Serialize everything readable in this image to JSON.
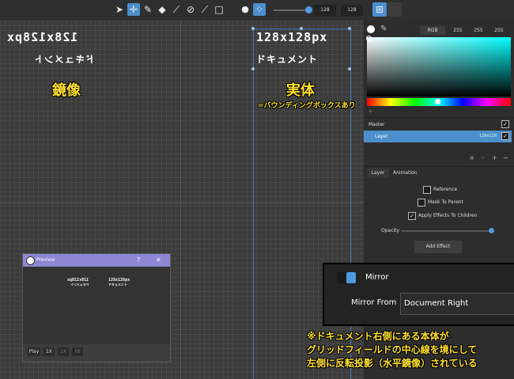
{
  "toolbar": {
    "tools": [
      "select-tool",
      "move-tool",
      "pen-tool",
      "eraser-tool",
      "line-tool",
      "fill-tool",
      "brush-tool",
      "rectangle-tool"
    ],
    "brush_size_a": "128",
    "brush_size_b": "128"
  },
  "canvas": {
    "mirror_line1": "128x128px",
    "mirror_line2": "ドキュメント",
    "mirror_label": "鏡像",
    "real_line1": "128x128px",
    "real_line2": "ドキュメント",
    "real_label": "実体",
    "real_sublabel": "=バウンディングボックスあり"
  },
  "color": {
    "mode": "RGB",
    "r": "255",
    "g": "255",
    "b": "255"
  },
  "layers": {
    "master": "Master",
    "layer": "Layer",
    "layer_info": "128x128"
  },
  "tabs": [
    "Layer",
    "Animation"
  ],
  "layer_props": {
    "reference": "Reference",
    "mask": "Mask To Parent",
    "apply_effects": "Apply Effects To Children",
    "opacity": "Opacity",
    "opacity_value": 1.0,
    "add_effect": "Add Effect"
  },
  "preview": {
    "title": "Preview",
    "help": "?",
    "close": "✕",
    "play": "Play",
    "zoom1": "1X",
    "zoom2": "2X",
    "fit": "Fit"
  },
  "mirror": {
    "toggle_label": "Mirror",
    "from_label": "Mirror From",
    "from_value": "Document Right"
  },
  "annotation": {
    "line1": "※ドキュメント右側にある本体が",
    "line2": "グリッドフィールドの中心線を境にして",
    "line3": "左側に反転投影（水平鏡像）されている"
  },
  "colors": {
    "accent": "#4d8fcc",
    "annotation": "#ffe030",
    "preview_title": "#8d87d4"
  }
}
